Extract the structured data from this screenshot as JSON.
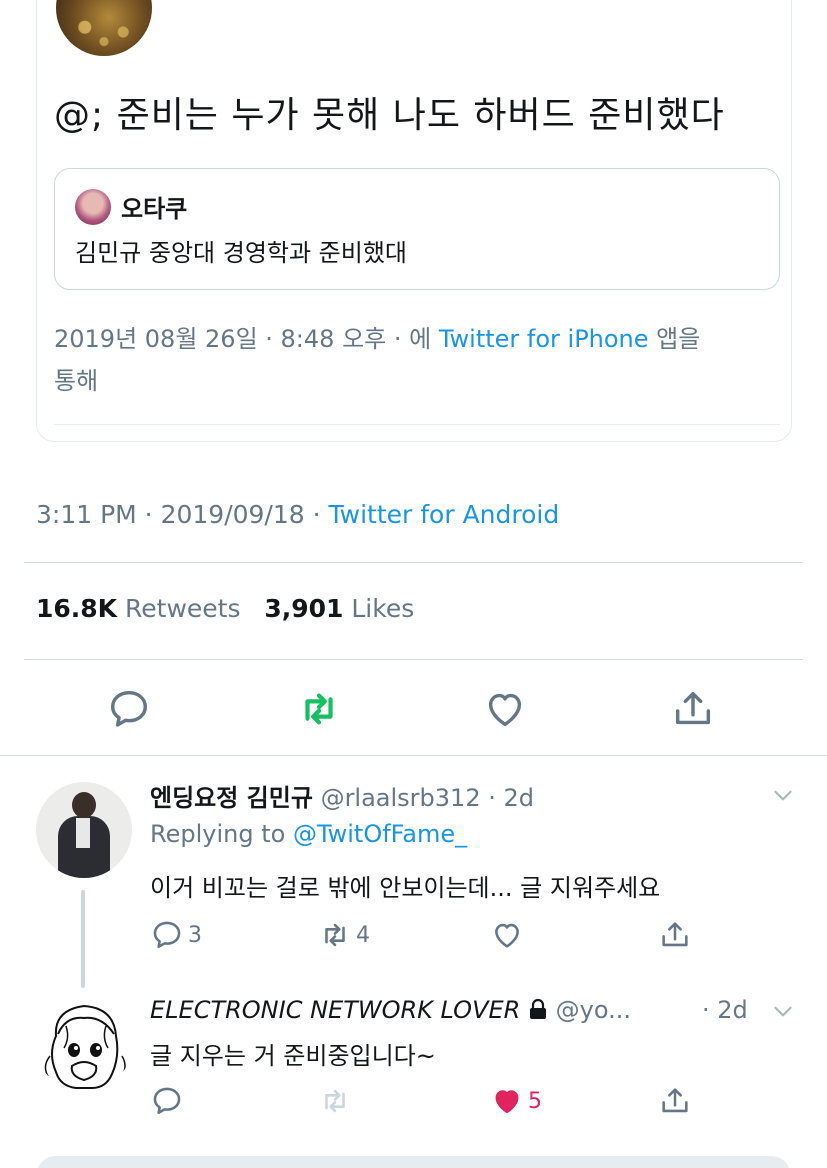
{
  "embedded_tweet": {
    "text": "@; 준비는 누가 못해 나도 하버드 준비했다",
    "quoted": {
      "name": "오타쿠",
      "text": "김민규 중앙대 경영학과 준비했대"
    },
    "meta_prefix": "2019년 08월 26일 · 8:48 오후 · 에 ",
    "meta_link": "Twitter for iPhone",
    "meta_suffix": " 앱을",
    "meta_line2": "통해"
  },
  "tweet": {
    "time": "3:11 PM · 2019/09/18 · ",
    "source": "Twitter for Android",
    "retweets_count": "16.8K",
    "retweets_label": "Retweets",
    "likes_count": "3,901",
    "likes_label": "Likes"
  },
  "actions": {
    "reply_icon": "reply-icon",
    "retweet_icon": "retweet-icon",
    "like_icon": "heart-icon",
    "share_icon": "share-icon"
  },
  "replies": [
    {
      "name": "엔딩요정 김민규",
      "handle": "@rlaalsrb312 · 2d",
      "replying_to_label": "Replying to ",
      "replying_to_handle": "@TwitOfFame_",
      "text": "이거 비꼬는 걸로 밖에 안보이는데...  글 지워주세요",
      "reply_count": "3",
      "retweet_count": "4",
      "like_count": "",
      "liked": false
    },
    {
      "name": "ELECTRONIC NETWORK LOVER",
      "handle": "@yo...",
      "time": "· 2d",
      "text": "글 지우는 거 준비중입니다~",
      "reply_count": "",
      "retweet_count": "",
      "like_count": "5",
      "liked": true
    }
  ],
  "colors": {
    "link": "#1b95e0",
    "retweet_green": "#17bf63",
    "like_red": "#e0245e",
    "muted": "#657786",
    "icon_gray": "#657786"
  }
}
